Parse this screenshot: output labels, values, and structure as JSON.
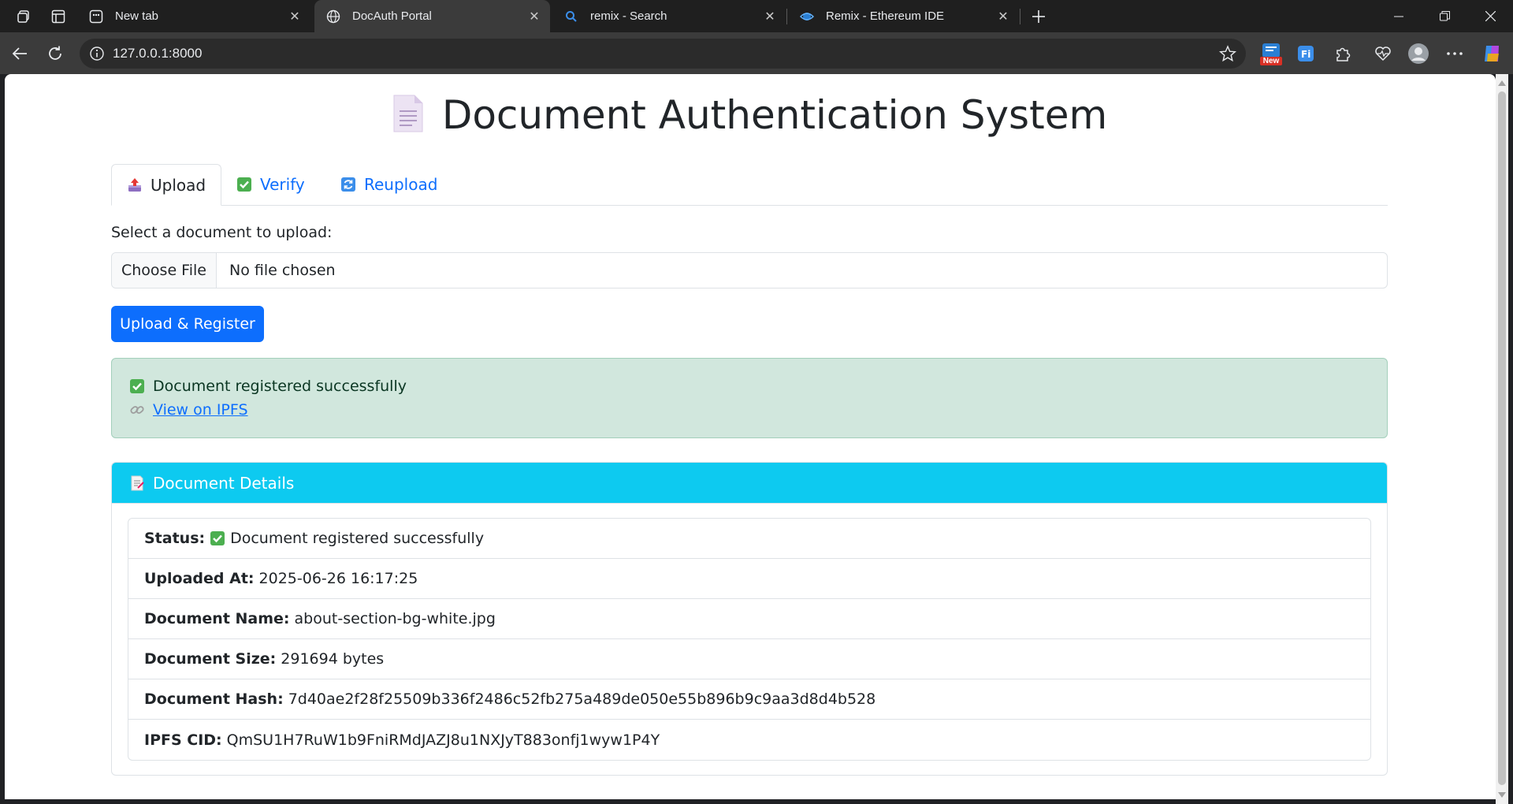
{
  "browser": {
    "tabs": [
      {
        "title": "New tab",
        "icon": "new-tab-icon",
        "active": false
      },
      {
        "title": "DocAuth Portal",
        "icon": "globe-icon",
        "active": true
      },
      {
        "title": "remix - Search",
        "icon": "search-icon",
        "active": false
      },
      {
        "title": "Remix - Ethereum IDE",
        "icon": "remix-icon",
        "active": false
      }
    ],
    "url": "127.0.0.1:8000",
    "extension_badge": "New"
  },
  "page": {
    "title": "Document Authentication System",
    "tabs": [
      {
        "label": "Upload",
        "icon": "inbox-tray-icon",
        "active": true
      },
      {
        "label": "Verify",
        "icon": "check-mark-icon",
        "active": false
      },
      {
        "label": "Reupload",
        "icon": "refresh-icon",
        "active": false
      }
    ],
    "upload": {
      "label": "Select a document to upload:",
      "choose_file": "Choose File",
      "file_status": "No file chosen",
      "submit": "Upload & Register"
    },
    "alert": {
      "message": "Document registered successfully",
      "link_text": "View on IPFS"
    },
    "details": {
      "header": "Document Details",
      "rows": [
        {
          "label": "Status:",
          "value": "Document registered successfully",
          "icon": "check-mark-icon"
        },
        {
          "label": "Uploaded At:",
          "value": "2025-06-26 16:17:25"
        },
        {
          "label": "Document Name:",
          "value": "about-section-bg-white.jpg"
        },
        {
          "label": "Document Size:",
          "value": "291694 bytes"
        },
        {
          "label": "Document Hash:",
          "value": "7d40ae2f28f25509b336f2486c52fb275a489de050e55b896b9c9aa3d8d4b528"
        },
        {
          "label": "IPFS CID:",
          "value": "QmSU1H7RuW1b9FniRMdJAZJ8u1NXJyT883onfj1wyw1P4Y"
        }
      ]
    }
  },
  "colors": {
    "primary": "#0d6efd",
    "info": "#0dcaf0",
    "success_bg": "#d1e7dd",
    "success_text": "#0a3622"
  }
}
